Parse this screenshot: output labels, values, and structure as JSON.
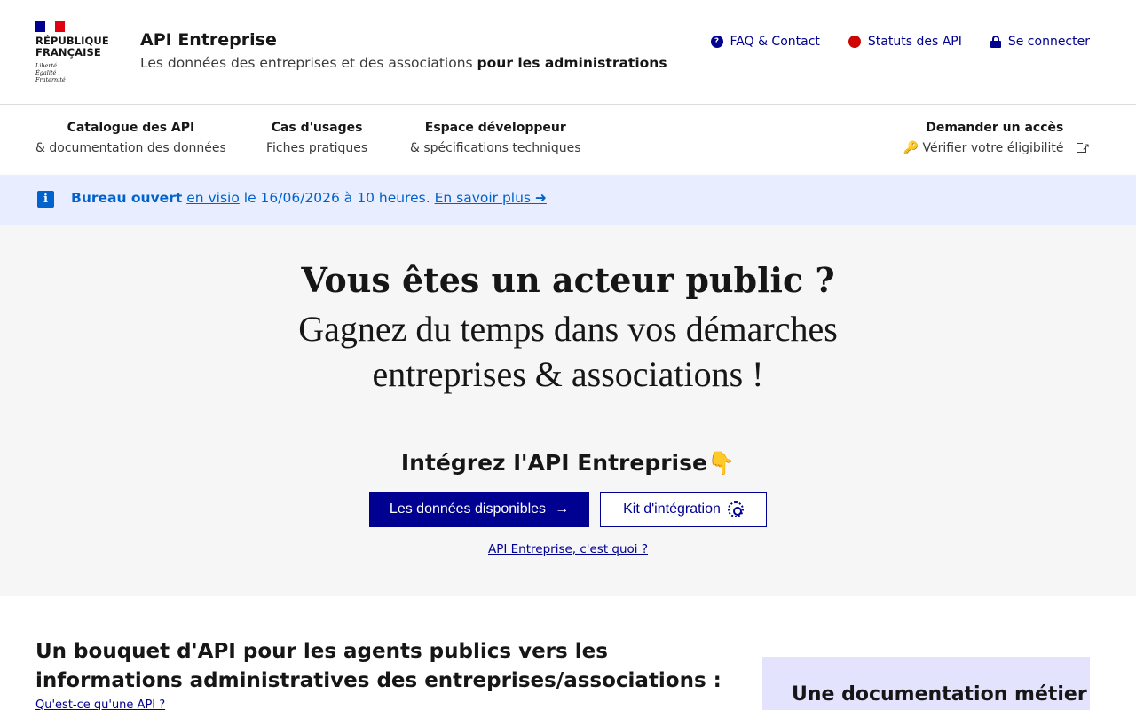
{
  "header": {
    "logo_text": "RÉPUBLIQUE FRANÇAISE",
    "motto": [
      "Liberté",
      "Égalité",
      "Fraternité"
    ],
    "title": "API Entreprise",
    "tagline_prefix": "Les données des entreprises et des associations",
    "tagline_bold": "pour les administrations",
    "tools": {
      "faq": "FAQ & Contact",
      "status": "Statuts des API",
      "login": "Se connecter"
    }
  },
  "nav": {
    "catalogue": {
      "title": "Catalogue des API",
      "subtitle": "& documentation des données"
    },
    "usages": {
      "title": "Cas d'usages",
      "subtitle": "Fiches pratiques"
    },
    "dev": {
      "title": "Espace développeur",
      "subtitle": "& spécifications techniques"
    },
    "access": {
      "title": "Demander un accès",
      "subtitle": "Vérifier votre éligibilité",
      "icon": "🔑"
    }
  },
  "notice": {
    "bold": "Bureau ouvert",
    "link1": "en visio",
    "text": "le 16/06/2026 à 10 heures.",
    "link2": "En savoir plus ➜"
  },
  "hero": {
    "title": "Vous êtes un acteur public ?",
    "subtitle_line1": "Gagnez du temps dans vos démarches",
    "subtitle_line2": "entreprises & associations !",
    "integrate": "Intégrez l'API Entreprise",
    "integrate_emoji": "👇",
    "btn_primary": "Les données disponibles",
    "btn_primary_arrow": "→",
    "btn_secondary": "Kit d'intégration",
    "link": "API Entreprise, c'est quoi ?"
  },
  "section": {
    "title": "Un bouquet d'API pour les agents publics vers les informations administratives des entreprises/associations :",
    "link": "Qu'est-ce qu'une API ?",
    "card_title": "Une documentation métier"
  },
  "colors": {
    "primary": "#000091",
    "notice_bg": "#e8edff",
    "info": "#0063cb",
    "hero_bg": "#f6f6f6",
    "status_dot": "#ce0500",
    "card_bg": "#e3e3fd"
  }
}
